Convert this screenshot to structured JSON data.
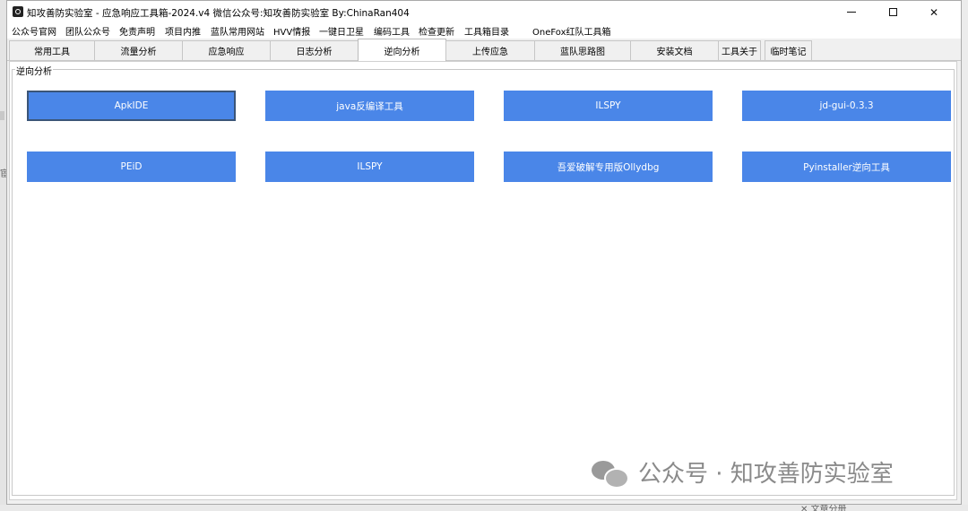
{
  "window": {
    "title": "知攻善防实验室 - 应急响应工具箱-2024.v4    微信公众号:知攻善防实验室   By:ChinaRan404",
    "controls": {
      "minimize": "minimize",
      "maximize": "maximize",
      "close": "✕"
    }
  },
  "menu": [
    "公众号官网",
    "团队公众号",
    "免责声明",
    "项目内推",
    "蓝队常用网站",
    "HVV情报",
    "一键日卫星",
    "编码工具",
    "检查更新",
    "工具箱目录",
    "OneFox红队工具箱"
  ],
  "tabs": [
    {
      "label": "常用工具",
      "active": false
    },
    {
      "label": "流量分析",
      "active": false
    },
    {
      "label": "应急响应",
      "active": false
    },
    {
      "label": "日志分析",
      "active": false
    },
    {
      "label": "逆向分析",
      "active": true
    },
    {
      "label": "上传应急",
      "active": false
    },
    {
      "label": "蓝队思路图",
      "active": false
    },
    {
      "label": "安装文档",
      "active": false
    },
    {
      "label": "工具关于",
      "active": false
    },
    {
      "label": "临时笔记",
      "active": false
    }
  ],
  "group": {
    "title": "逆向分析",
    "buttons": [
      "ApkIDE",
      "java反编译工具",
      "ILSPY",
      "jd-gui-0.3.3",
      "PEiD",
      "ILSPY",
      "吾爱破解专用版Ollydbg",
      "Pyinstaller逆向工具"
    ]
  },
  "watermark": {
    "text": "公众号 · 知攻善防实验室"
  },
  "background": {
    "peek_text": "✕ 文章分册",
    "left_text": "宦"
  },
  "colors": {
    "button_bg": "#4a86e8",
    "button_text": "#ffffff"
  }
}
